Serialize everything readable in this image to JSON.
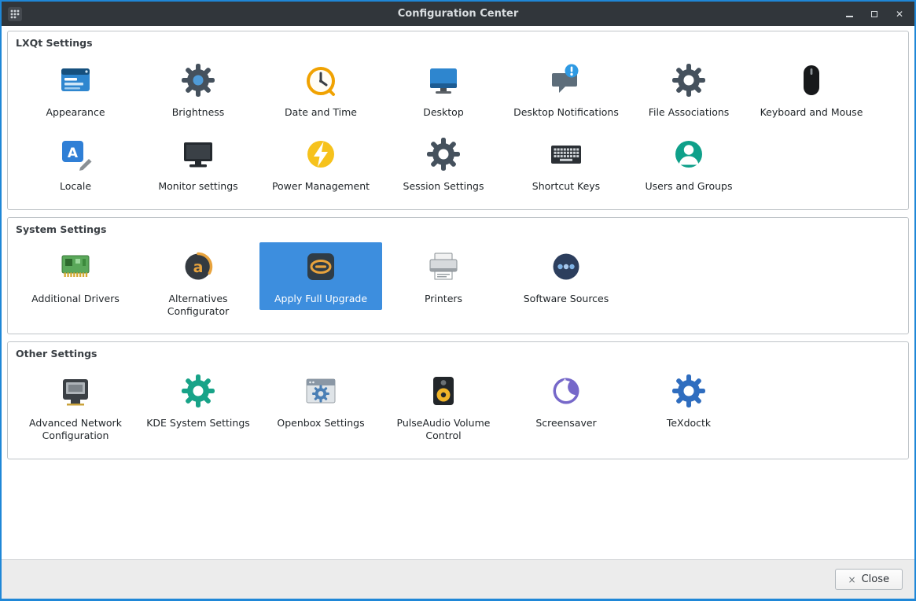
{
  "window": {
    "title": "Configuration Center"
  },
  "colors": {
    "accent": "#1f87d7",
    "titlebar": "#31363b",
    "selection": "#3d8ede"
  },
  "sections": [
    {
      "title": "LXQt Settings",
      "items": [
        {
          "label": "Appearance",
          "icon": "appearance-icon"
        },
        {
          "label": "Brightness",
          "icon": "brightness-icon"
        },
        {
          "label": "Date and Time",
          "icon": "date-time-icon"
        },
        {
          "label": "Desktop",
          "icon": "desktop-icon"
        },
        {
          "label": "Desktop Notifications",
          "icon": "desktop-notifications-icon"
        },
        {
          "label": "File Associations",
          "icon": "file-associations-icon"
        },
        {
          "label": "Keyboard and Mouse",
          "icon": "keyboard-mouse-icon"
        },
        {
          "label": "Locale",
          "icon": "locale-icon"
        },
        {
          "label": "Monitor settings",
          "icon": "monitor-settings-icon"
        },
        {
          "label": "Power Management",
          "icon": "power-management-icon"
        },
        {
          "label": "Session Settings",
          "icon": "session-settings-icon"
        },
        {
          "label": "Shortcut Keys",
          "icon": "shortcut-keys-icon"
        },
        {
          "label": "Users and Groups",
          "icon": "users-groups-icon"
        }
      ]
    },
    {
      "title": "System Settings",
      "items": [
        {
          "label": "Additional Drivers",
          "icon": "additional-drivers-icon"
        },
        {
          "label": "Alternatives Configurator",
          "icon": "alternatives-configurator-icon"
        },
        {
          "label": "Apply Full Upgrade",
          "icon": "apply-full-upgrade-icon",
          "selected": true
        },
        {
          "label": "Printers",
          "icon": "printers-icon"
        },
        {
          "label": "Software Sources",
          "icon": "software-sources-icon"
        }
      ]
    },
    {
      "title": "Other Settings",
      "items": [
        {
          "label": "Advanced Network Configuration",
          "icon": "advanced-network-icon"
        },
        {
          "label": "KDE System Settings",
          "icon": "kde-system-settings-icon"
        },
        {
          "label": "Openbox Settings",
          "icon": "openbox-settings-icon"
        },
        {
          "label": "PulseAudio Volume Control",
          "icon": "pulseaudio-icon"
        },
        {
          "label": "Screensaver",
          "icon": "screensaver-icon"
        },
        {
          "label": "TeXdoctk",
          "icon": "texdoctk-icon"
        }
      ]
    }
  ],
  "footer": {
    "close_label": "Close",
    "close_icon": "×"
  }
}
